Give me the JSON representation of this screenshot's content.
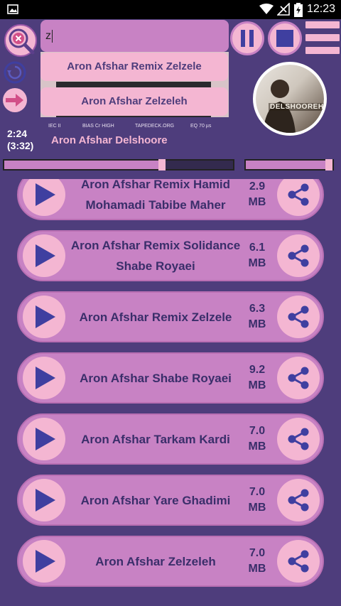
{
  "status_bar": {
    "time": "12:23"
  },
  "search": {
    "value": "z"
  },
  "suggestions": [
    "Aron Afshar Remix Zelzele",
    "Aron Afshar Zelzeleh"
  ],
  "tape_labels": [
    "IEC II",
    "BIAS Cr HIGH",
    "TAPEDECK.ORG",
    "EQ 70 µs"
  ],
  "player": {
    "current_time": "2:24",
    "total_time": "(3:32)",
    "now_playing": "Aron Afshar Delshoore",
    "album_art_text": "DELSHOOREH",
    "progress": 0.69
  },
  "tracks": [
    {
      "title": "Aron Afshar Remix Hamid Mohamadi Tabibe Maher",
      "size": "2.9 MB"
    },
    {
      "title": "Aron Afshar Remix Solidance Shabe Royaei",
      "size": "6.1 MB"
    },
    {
      "title": "Aron Afshar Remix Zelzele",
      "size": "6.3 MB"
    },
    {
      "title": "Aron Afshar Shabe Royaei",
      "size": "9.2 MB"
    },
    {
      "title": "Aron Afshar Tarkam Kardi",
      "size": "7.0 MB"
    },
    {
      "title": "Aron Afshar Yare Ghadimi",
      "size": "7.0 MB"
    },
    {
      "title": "Aron Afshar Zelzeleh",
      "size": "7.0 MB"
    }
  ],
  "colors": {
    "background": "#4e3d7c",
    "row": "#c882c4",
    "button": "#f4b6d2",
    "icon": "#3f3fa0"
  }
}
